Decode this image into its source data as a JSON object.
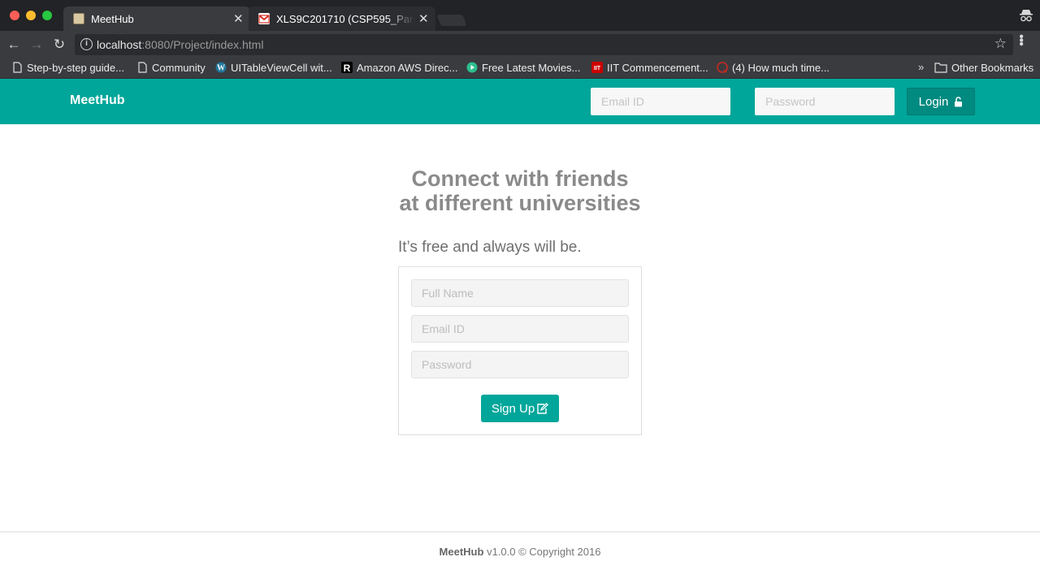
{
  "browser": {
    "tabs": [
      {
        "title": "MeetHub",
        "active": true
      },
      {
        "title": "XLS9C201710 (CSP595_Pare",
        "active": false
      }
    ],
    "url": {
      "host": "localhost",
      "rest": ":8080/Project/index.html"
    },
    "bookmarks": [
      {
        "label": "Step-by-step guide...",
        "icon": "page-icon"
      },
      {
        "label": "Community",
        "icon": "page-icon"
      },
      {
        "label": "UITableViewCell wit...",
        "icon": "wordpress-icon"
      },
      {
        "label": "Amazon AWS Direc...",
        "icon": "r-icon"
      },
      {
        "label": "Free Latest Movies...",
        "icon": "play-icon"
      },
      {
        "label": "IIT Commencement...",
        "icon": "iit-icon"
      },
      {
        "label": "(4) How much time...",
        "icon": "quora-icon"
      }
    ],
    "other_bookmarks": "Other Bookmarks",
    "more_glyph": "»"
  },
  "navbar": {
    "brand": "MeetHub",
    "email_placeholder": "Email ID",
    "password_placeholder": "Password",
    "login_label": "Login",
    "accent": "#00a69a"
  },
  "hero": {
    "line1": "Connect with friends",
    "line2": "at different universities",
    "tagline": "It’s free and always will be."
  },
  "signup": {
    "full_name_placeholder": "Full Name",
    "email_placeholder": "Email ID",
    "password_placeholder": "Password",
    "button_label": "Sign Up"
  },
  "footer": {
    "brand": "MeetHub",
    "text": "v1.0.0 © Copyright 2016"
  }
}
